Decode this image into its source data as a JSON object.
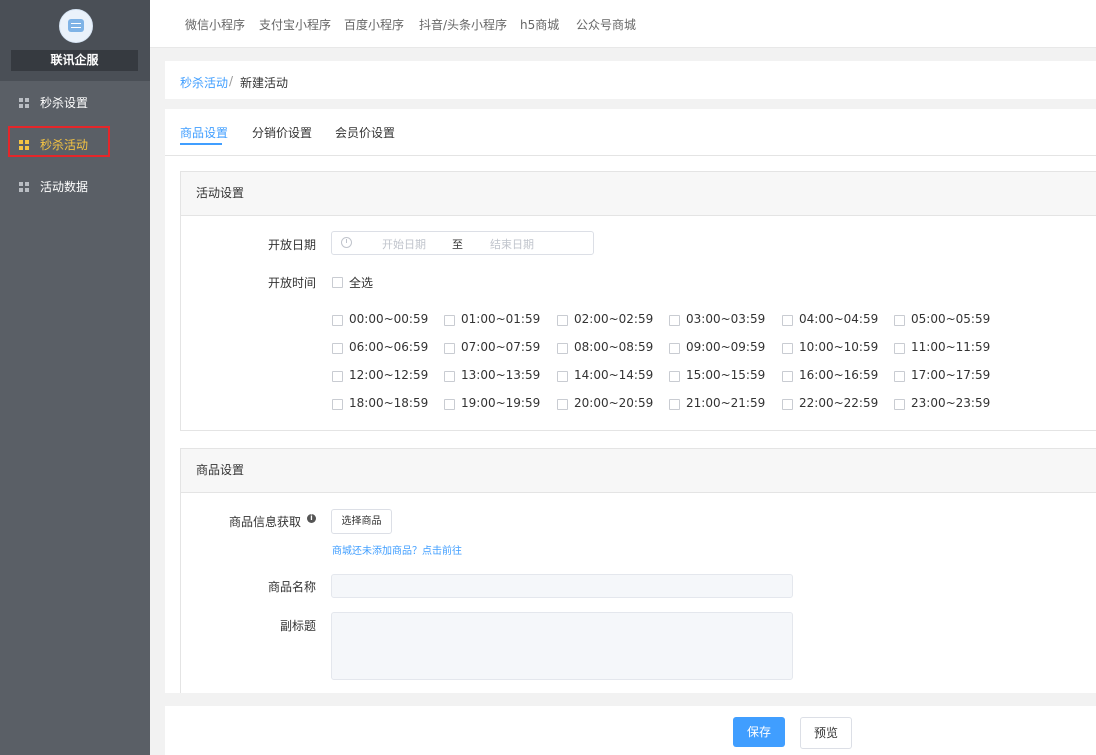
{
  "sidebar": {
    "brand": "联讯企服",
    "items": [
      {
        "label": "秒杀设置"
      },
      {
        "label": "秒杀活动"
      },
      {
        "label": "活动数据"
      }
    ]
  },
  "topnav": {
    "items": [
      "微信小程序",
      "支付宝小程序",
      "百度小程序",
      "抖音/头条小程序",
      "h5商城",
      "公众号商城"
    ]
  },
  "breadcrumb": {
    "parent": "秒杀活动",
    "separator": "/",
    "current": "新建活动"
  },
  "tabs": [
    "商品设置",
    "分销价设置",
    "会员价设置"
  ],
  "activity_settings": {
    "title": "活动设置",
    "open_date_label": "开放日期",
    "start_placeholder": "开始日期",
    "range_separator": "至",
    "end_placeholder": "结束日期",
    "open_time_label": "开放时间",
    "select_all_label": "全选",
    "time_slots": [
      "00:00~00:59",
      "01:00~01:59",
      "02:00~02:59",
      "03:00~03:59",
      "04:00~04:59",
      "05:00~05:59",
      "06:00~06:59",
      "07:00~07:59",
      "08:00~08:59",
      "09:00~09:59",
      "10:00~10:59",
      "11:00~11:59",
      "12:00~12:59",
      "13:00~13:59",
      "14:00~14:59",
      "15:00~15:59",
      "16:00~16:59",
      "17:00~17:59",
      "18:00~18:59",
      "19:00~19:59",
      "20:00~20:59",
      "21:00~21:59",
      "22:00~22:59",
      "23:00~23:59"
    ]
  },
  "goods_settings": {
    "title": "商品设置",
    "info_label": "商品信息获取",
    "info_icon_glyph": "i",
    "select_button": "选择商品",
    "hint": "商城还未添加商品？点击前往",
    "name_label": "商品名称",
    "name_value": "",
    "subtitle_label": "副标题",
    "subtitle_value": ""
  },
  "footer": {
    "save": "保存",
    "preview": "预览"
  },
  "colors": {
    "primary": "#409eff",
    "sidebar_bg": "#5a5f66",
    "active_item": "#f5c442",
    "highlight_box": "#e5262a"
  }
}
